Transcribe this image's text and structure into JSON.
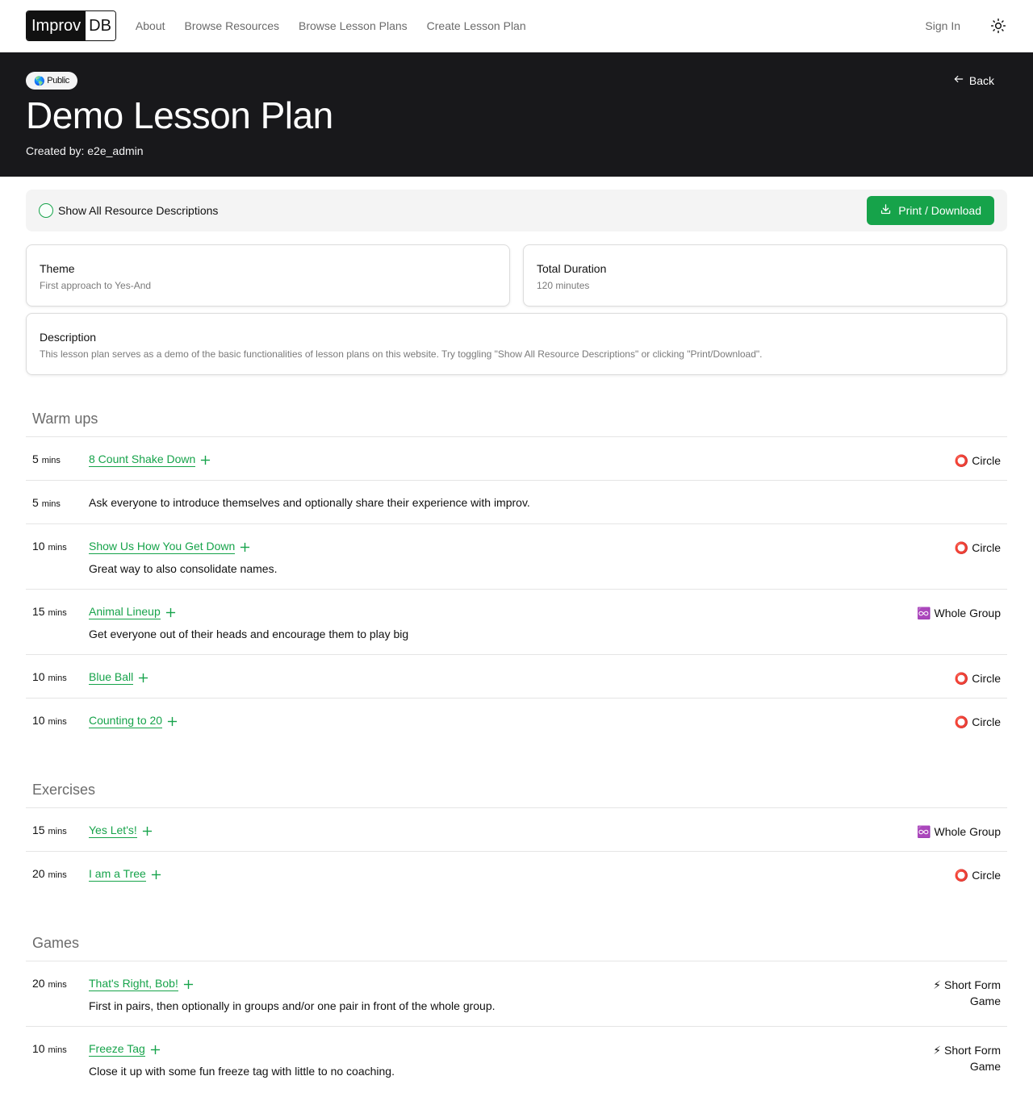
{
  "nav": {
    "logo_a": "Improv",
    "logo_b": "DB",
    "links": [
      "About",
      "Browse Resources",
      "Browse Lesson Plans",
      "Create Lesson Plan"
    ],
    "sign_in": "Sign In",
    "theme_icon": "sun-icon"
  },
  "hero": {
    "badge_emoji": "🌎",
    "badge": "Public",
    "title": "Demo Lesson Plan",
    "created": "Created by: e2e_admin",
    "back": "Back"
  },
  "controls": {
    "toggle_label": "Show All Resource Descriptions",
    "print_label": "Print / Download"
  },
  "info": {
    "theme_title": "Theme",
    "theme_value": "First approach to Yes-And",
    "duration_title": "Total Duration",
    "duration_value": "120 minutes",
    "description_title": "Description",
    "description_value": "This lesson plan serves as a demo of the basic functionalities of lesson plans on this website. Try toggling \"Show All Resource Descriptions\" or clicking \"Print/Download\"."
  },
  "mins_label": "mins",
  "sections": [
    {
      "title": "Warm ups",
      "items": [
        {
          "mins": "5",
          "link": "8 Count Shake Down",
          "desc": "",
          "tag_emoji": "⭕",
          "tag": "Circle"
        },
        {
          "mins": "5",
          "link": "",
          "desc": "Ask everyone to introduce themselves and optionally share their experience with improv.",
          "tag_emoji": "",
          "tag": ""
        },
        {
          "mins": "10",
          "link": "Show Us How You Get Down",
          "desc": "Great way to also consolidate names.",
          "tag_emoji": "⭕",
          "tag": "Circle"
        },
        {
          "mins": "15",
          "link": "Animal Lineup",
          "desc": "Get everyone out of their heads and encourage them to play big",
          "tag_emoji": "♾️",
          "tag": "Whole Group"
        },
        {
          "mins": "10",
          "link": "Blue Ball",
          "desc": "",
          "tag_emoji": "⭕",
          "tag": "Circle"
        },
        {
          "mins": "10",
          "link": "Counting to 20",
          "desc": "",
          "tag_emoji": "⭕",
          "tag": "Circle"
        }
      ]
    },
    {
      "title": "Exercises",
      "items": [
        {
          "mins": "15",
          "link": "Yes Let's!",
          "desc": "",
          "tag_emoji": "♾️",
          "tag": "Whole Group"
        },
        {
          "mins": "20",
          "link": "I am a Tree",
          "desc": "",
          "tag_emoji": "⭕",
          "tag": "Circle"
        }
      ]
    },
    {
      "title": "Games",
      "items": [
        {
          "mins": "20",
          "link": "That's Right, Bob!",
          "desc": "First in pairs, then optionally in groups and/or one pair in front of the whole group.",
          "tag_emoji": "⚡",
          "tag": "Short Form Game"
        },
        {
          "mins": "10",
          "link": "Freeze Tag",
          "desc": "Close it up with some fun freeze tag with little to no coaching.",
          "tag_emoji": "⚡",
          "tag": "Short Form Game"
        }
      ]
    }
  ],
  "colors": {
    "accent": "#16a34a",
    "hero_bg": "#18181b"
  }
}
